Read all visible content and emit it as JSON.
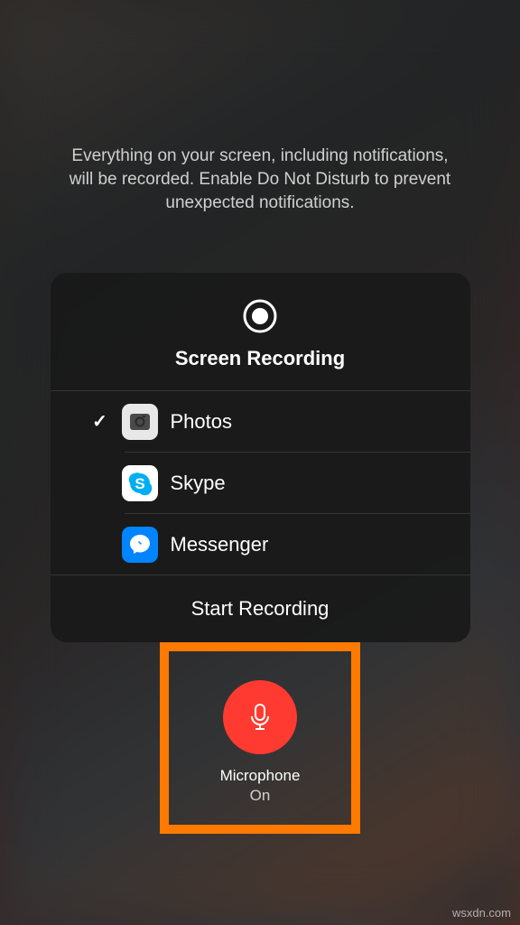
{
  "instruction": "Everything on your screen, including notifications, will be recorded. Enable Do Not Disturb to prevent unexpected notifications.",
  "panel": {
    "title": "Screen Recording",
    "apps": [
      {
        "name": "Photos",
        "checked": true
      },
      {
        "name": "Skype",
        "checked": false
      },
      {
        "name": "Messenger",
        "checked": false
      }
    ],
    "start_label": "Start Recording"
  },
  "microphone": {
    "label": "Microphone",
    "status": "On"
  },
  "watermark": "wsxdn.com"
}
